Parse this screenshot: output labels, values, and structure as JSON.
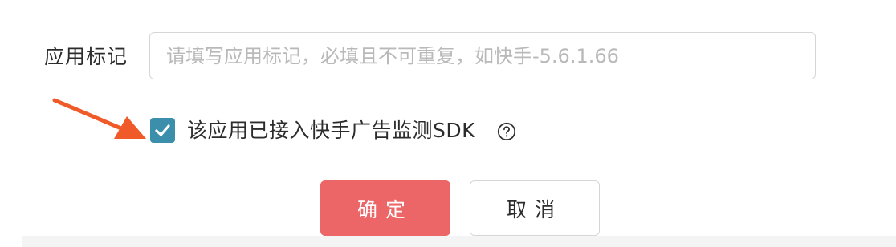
{
  "form": {
    "app_tag_label": "应用标记",
    "app_tag_placeholder": "请填写应用标记，必填且不可重复，如快手-5.6.1.66",
    "app_tag_value": "",
    "sdk_checkbox_checked": true,
    "sdk_checkbox_label": "该应用已接入快手广告监测SDK"
  },
  "actions": {
    "confirm_label": "确定",
    "cancel_label": "取消"
  },
  "colors": {
    "primary": "#ec6567",
    "checkbox": "#3b8faa",
    "arrow": "#ef5a28",
    "border": "#d6d6d6",
    "placeholder": "#b9b9b9"
  },
  "icons": {
    "arrow": "arrow-annotation-icon",
    "check": "check-icon",
    "help": "question-circle-icon"
  }
}
